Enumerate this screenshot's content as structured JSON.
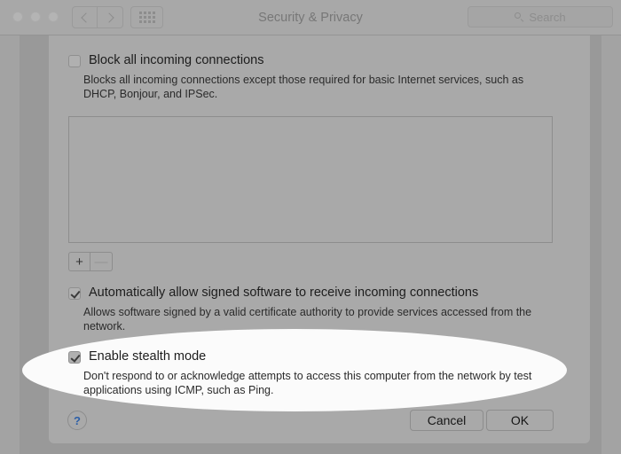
{
  "window": {
    "title": "Security & Privacy",
    "traffic_lights": [
      "close",
      "minimize",
      "zoom"
    ],
    "nav": {
      "back_label": "Back",
      "forward_label": "Forward"
    },
    "show_all_label": "Show All",
    "search": {
      "placeholder": "Search",
      "value": ""
    }
  },
  "sheet": {
    "block_all": {
      "label": "Block all incoming connections",
      "checked": false,
      "description_line1": "Blocks all incoming connections except those required for basic Internet services,  such as",
      "description_line2": "DHCP, Bonjour, and IPSec."
    },
    "app_list": {
      "items": [],
      "add_label": "+",
      "remove_label": "—"
    },
    "auto_allow": {
      "label": "Automatically allow signed software to receive incoming connections",
      "checked": true,
      "description_line1": "Allows software signed by a valid certificate authority to provide services accessed from the",
      "description_line2": "network."
    },
    "stealth_mode": {
      "label": "Enable stealth mode",
      "checked": true,
      "description_line1": "Don't respond to or acknowledge attempts to access this computer from the network by test",
      "description_line2": "applications using ICMP, such as Ping."
    },
    "footer": {
      "help_label": "?",
      "cancel_label": "Cancel",
      "ok_label": "OK"
    }
  },
  "annotation": {
    "highlight_shape": "ellipse",
    "highlight_color": "#fbfbfb",
    "highlight_target": "Enable stealth mode"
  },
  "colors": {
    "desktop": "#a3a3a3",
    "window": "#999999",
    "sheet": "#a9a9a9",
    "titlebar": "#a8a8a8",
    "help_blue": "#2c5fa8"
  }
}
